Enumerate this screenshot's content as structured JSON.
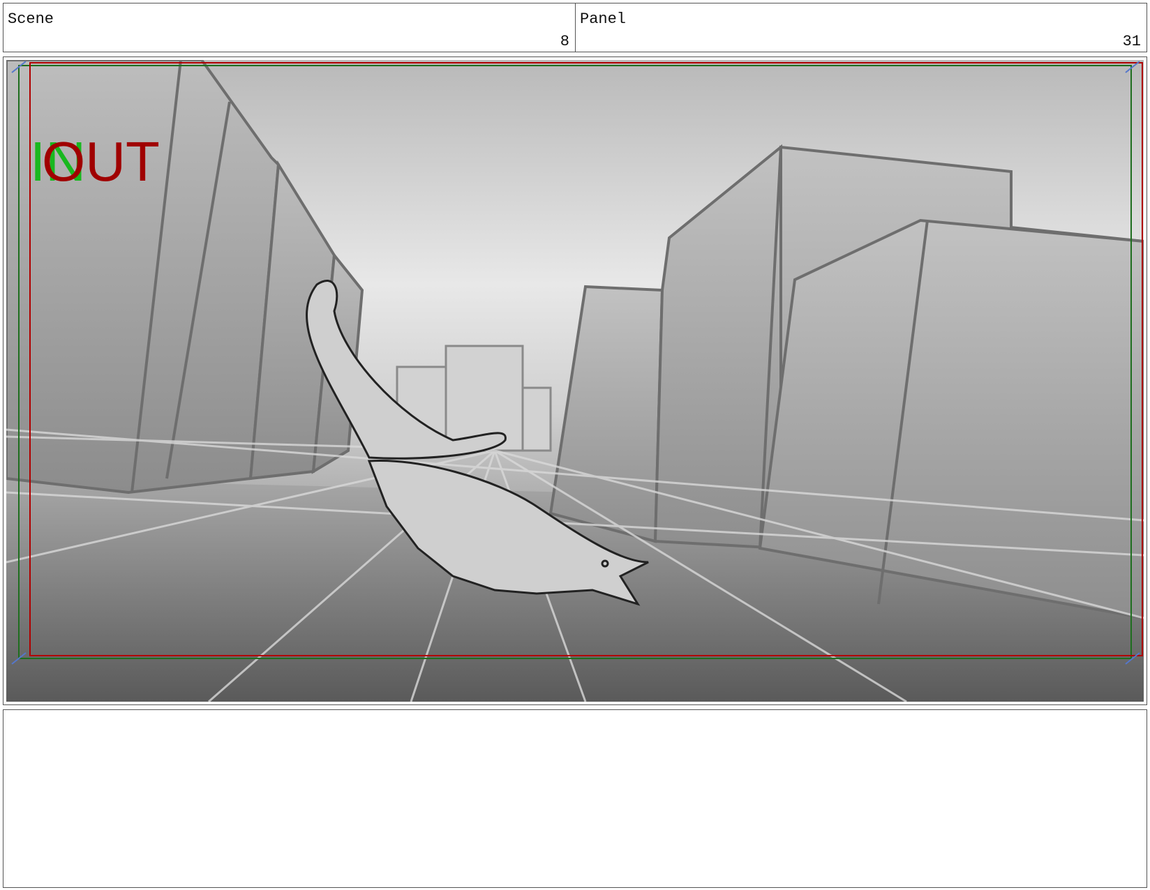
{
  "header": {
    "scene_label": "Scene",
    "scene_number": "8",
    "panel_label": "Panel",
    "panel_number": "31"
  },
  "frame": {
    "in_marker": "IN",
    "out_marker": "OUT",
    "in_color": "#19b81f",
    "out_color": "#a00000",
    "safe_frame_green": "#1f6e1f",
    "safe_frame_red": "#b00000",
    "corner_marker_color": "#5577cc"
  },
  "notes": {
    "text": ""
  }
}
